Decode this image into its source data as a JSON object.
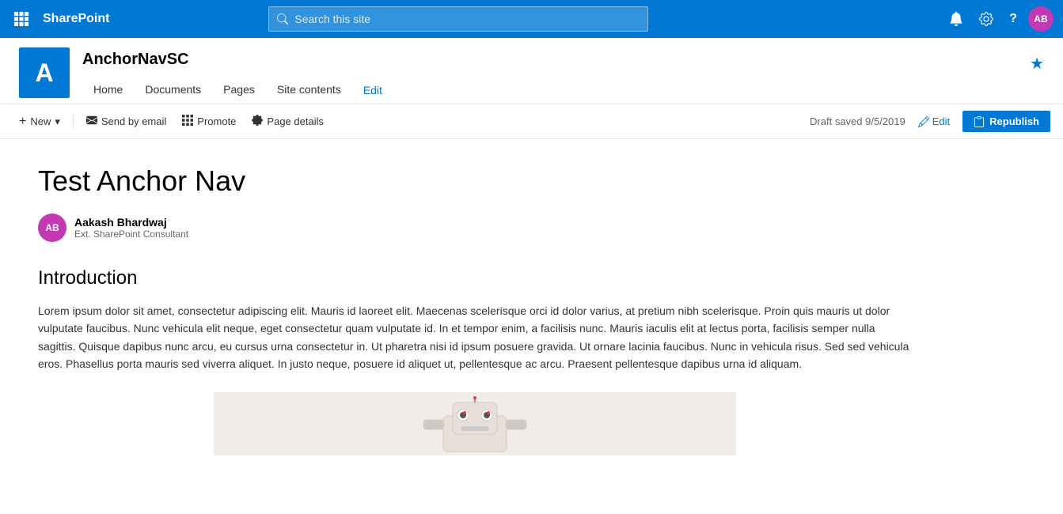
{
  "topnav": {
    "waffle_icon": "⊞",
    "app_name": "SharePoint",
    "search_placeholder": "Search this site",
    "notification_icon": "🔔",
    "settings_icon": "⚙",
    "help_icon": "?",
    "avatar_initials": "AB"
  },
  "site_header": {
    "logo_letter": "A",
    "site_name": "AnchorNavSC",
    "nav_items": [
      {
        "label": "Home",
        "active": false
      },
      {
        "label": "Documents",
        "active": false
      },
      {
        "label": "Pages",
        "active": false
      },
      {
        "label": "Site contents",
        "active": false
      }
    ],
    "edit_label": "Edit",
    "star_icon": "★"
  },
  "toolbar": {
    "new_label": "New",
    "new_dropdown_icon": "▾",
    "send_email_icon": "✉",
    "send_email_label": "Send by email",
    "promote_icon": "◱",
    "promote_label": "Promote",
    "page_details_icon": "⚙",
    "page_details_label": "Page details",
    "draft_status": "Draft saved 9/5/2019",
    "edit_icon": "✏",
    "edit_label": "Edit",
    "republish_icon": "📋",
    "republish_label": "Republish"
  },
  "page": {
    "title": "Test Anchor Nav",
    "author": {
      "initials": "AB",
      "name": "Aakash Bhardwaj",
      "role": "Ext. SharePoint Consultant"
    },
    "section_heading": "Introduction",
    "body_text": "Lorem ipsum dolor sit amet, consectetur adipiscing elit. Mauris id laoreet elit. Maecenas scelerisque orci id dolor varius, at pretium nibh scelerisque. Proin quis mauris ut dolor vulputate faucibus. Nunc vehicula elit neque, eget consectetur quam vulputate id. In et tempor enim, a facilisis nunc. Mauris iaculis elit at lectus porta, facilisis semper nulla sagittis. Quisque dapibus nunc arcu, eu cursus urna consectetur in. Ut pharetra nisi id ipsum posuere gravida. Ut ornare lacinia faucibus. Nunc in vehicula risus. Sed sed vehicula eros. Phasellus porta mauris sed viverra aliquet. In justo neque, posuere id aliquet ut, pellentesque ac arcu. Praesent pellentesque dapibus urna id aliquam."
  },
  "colors": {
    "sharepoint_blue": "#0078d4",
    "avatar_purple": "#c239b3",
    "bg_white": "#ffffff",
    "text_dark": "#000000",
    "text_muted": "#666666"
  }
}
